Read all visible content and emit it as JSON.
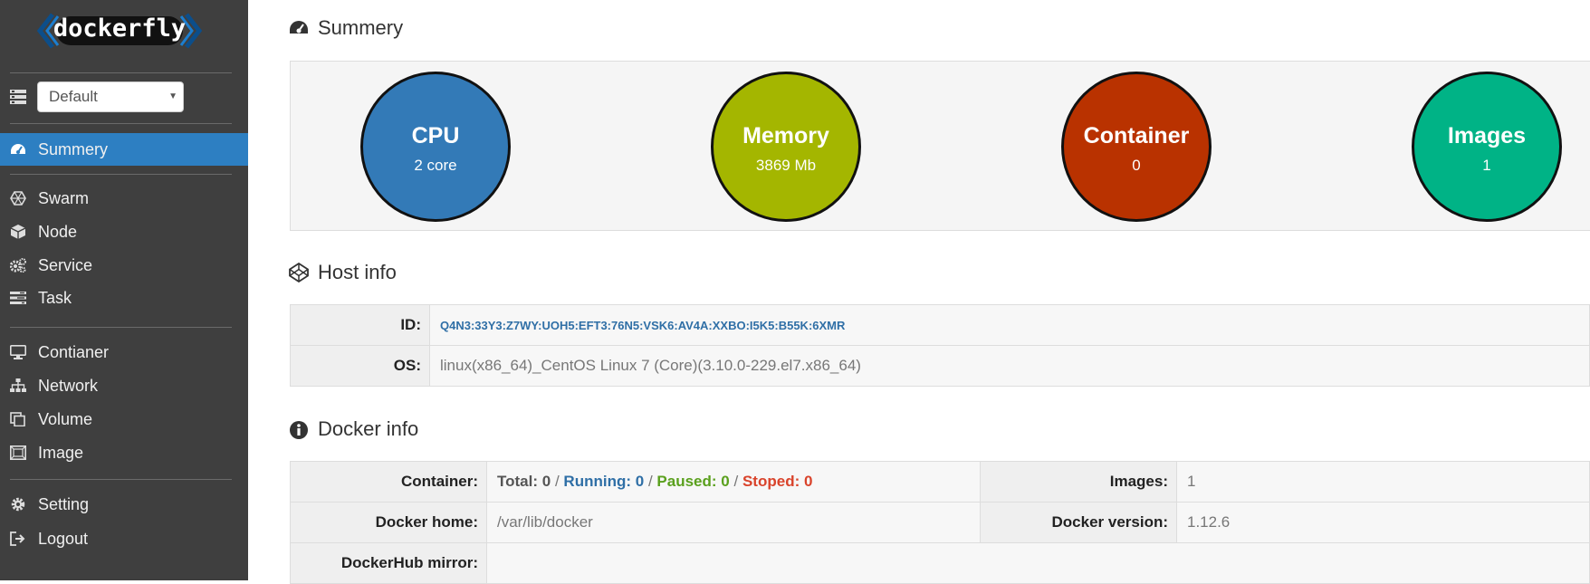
{
  "sidebar": {
    "logo_text": "dockerfly",
    "environment": {
      "selected": "Default"
    },
    "items": [
      {
        "id": "summery",
        "label": "Summery",
        "icon": "dashboard-icon",
        "active": true
      },
      {
        "id": "swarm",
        "label": "Swarm",
        "icon": "swarm-icon"
      },
      {
        "id": "node",
        "label": "Node",
        "icon": "cube-icon"
      },
      {
        "id": "service",
        "label": "Service",
        "icon": "cogs-icon"
      },
      {
        "id": "task",
        "label": "Task",
        "icon": "tasks-icon"
      },
      {
        "id": "contianer",
        "label": "Contianer",
        "icon": "desktop-icon"
      },
      {
        "id": "network",
        "label": "Network",
        "icon": "sitemap-icon"
      },
      {
        "id": "volume",
        "label": "Volume",
        "icon": "clone-icon"
      },
      {
        "id": "image",
        "label": "Image",
        "icon": "image-icon"
      },
      {
        "id": "setting",
        "label": "Setting",
        "icon": "gear-icon"
      },
      {
        "id": "logout",
        "label": "Logout",
        "icon": "sign-out-icon"
      }
    ]
  },
  "summary": {
    "title": "Summery",
    "stats": [
      {
        "title": "CPU",
        "value": "2 core",
        "color": "#337ab7"
      },
      {
        "title": "Memory",
        "value": "3869 Mb",
        "color": "#a4b600"
      },
      {
        "title": "Container",
        "value": "0",
        "color": "#b93200"
      },
      {
        "title": "Images",
        "value": "1",
        "color": "#00b386"
      }
    ]
  },
  "host_info": {
    "title": "Host info",
    "id_label": "ID:",
    "id_value": "Q4N3:33Y3:Z7WY:UOH5:EFT3:76N5:VSK6:AV4A:XXBO:I5K5:B55K:6XMR",
    "os_label": "OS:",
    "os_value": "linux(x86_64)_CentOS Linux 7 (Core)(3.10.0-229.el7.x86_64)"
  },
  "docker_info": {
    "title": "Docker info",
    "container_label": "Container:",
    "container": {
      "total_label": "Total:",
      "total": "0",
      "running_label": "Running:",
      "running": "0",
      "paused_label": "Paused:",
      "paused": "0",
      "stoped_label": "Stoped:",
      "stoped": "0",
      "sep": "/"
    },
    "images_label": "Images:",
    "images_value": "1",
    "home_label": "Docker home:",
    "home_value": "/var/lib/docker",
    "version_label": "Docker version:",
    "version_value": "1.12.6",
    "mirror_label": "DockerHub mirror:",
    "mirror_value": ""
  },
  "colors": {
    "sidebar_bg": "#3f3f3f",
    "active_item": "#2d7fc2"
  }
}
